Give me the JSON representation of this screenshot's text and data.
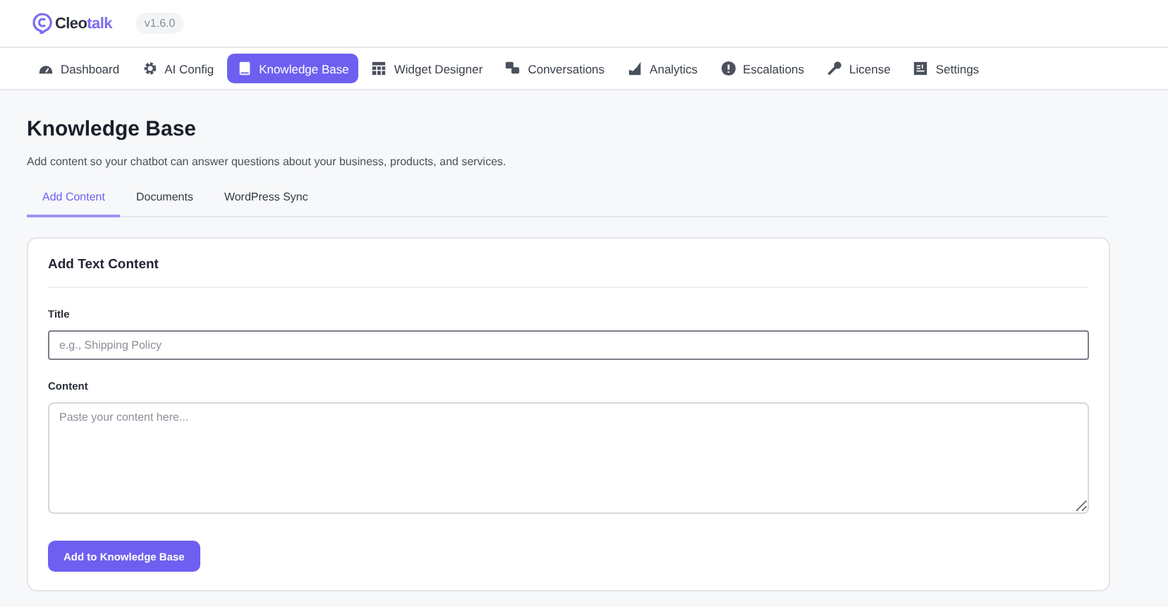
{
  "header": {
    "brand": {
      "first": "Cleo",
      "second": "talk"
    },
    "version": "v1.6.0"
  },
  "nav": [
    {
      "label": "Dashboard",
      "selected": false
    },
    {
      "label": "AI Config",
      "selected": false
    },
    {
      "label": "Knowledge Base",
      "selected": true
    },
    {
      "label": "Widget Designer",
      "selected": false
    },
    {
      "label": "Conversations",
      "selected": false
    },
    {
      "label": "Analytics",
      "selected": false
    },
    {
      "label": "Escalations",
      "selected": false
    },
    {
      "label": "License",
      "selected": false
    },
    {
      "label": "Settings",
      "selected": false
    }
  ],
  "page": {
    "title": "Knowledge Base",
    "subtitle": "Add content so your chatbot can answer questions about your business, products, and services."
  },
  "tabs": [
    {
      "label": "Add Content",
      "selected": true
    },
    {
      "label": "Documents",
      "selected": false
    },
    {
      "label": "WordPress Sync",
      "selected": false
    }
  ],
  "card": {
    "title": "Add Text Content",
    "fields": [
      {
        "label": "Title",
        "placeholder": "e.g., Shipping Policy",
        "kind": "input"
      },
      {
        "label": "Content",
        "placeholder": "Paste your content here...",
        "kind": "textarea"
      }
    ],
    "button": "Add to Knowledge Base"
  }
}
